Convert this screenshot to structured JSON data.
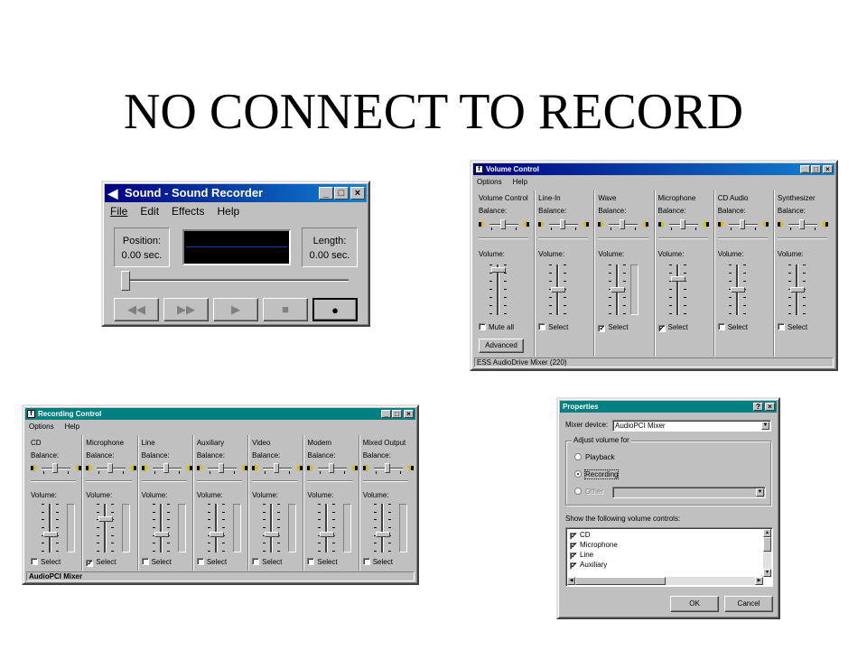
{
  "slide_title": "NO CONNECT TO RECORD",
  "sound_recorder": {
    "title": "Sound - Sound Recorder",
    "menu": [
      "File",
      "Edit",
      "Effects",
      "Help"
    ],
    "position_label": "Position:",
    "position_value": "0.00 sec.",
    "length_label": "Length:",
    "length_value": "0.00 sec.",
    "buttons": {
      "rewind": "◀◀",
      "forward": "▶▶",
      "play": "▶",
      "stop": "■",
      "record": "●"
    }
  },
  "volume_control": {
    "title": "Volume Control",
    "menu": [
      "Options",
      "Help"
    ],
    "balance_label": "Balance:",
    "volume_label": "Volume:",
    "columns": [
      {
        "name": "Volume Control",
        "check_label": "Mute all",
        "checked": false,
        "level": 0.95
      },
      {
        "name": "Line-In",
        "check_label": "Select",
        "checked": false,
        "level": 0.5
      },
      {
        "name": "Wave",
        "check_label": "Select",
        "checked": true,
        "level": 0.5
      },
      {
        "name": "Microphone",
        "check_label": "Select",
        "checked": true,
        "level": 0.75
      },
      {
        "name": "CD Audio",
        "check_label": "Select",
        "checked": false,
        "level": 0.5
      },
      {
        "name": "Synthesizer",
        "check_label": "Select",
        "checked": false,
        "level": 0.5
      }
    ],
    "advanced_label": "Advanced",
    "status": "ESS AudioDrive Mixer (220)"
  },
  "recording_control": {
    "title": "Recording Control",
    "menu": [
      "Options",
      "Help"
    ],
    "balance_label": "Balance:",
    "volume_label": "Volume:",
    "check_label": "Select",
    "columns": [
      {
        "name": "CD",
        "checked": false,
        "level": 0.35
      },
      {
        "name": "Microphone",
        "checked": true,
        "level": 0.7
      },
      {
        "name": "Line",
        "checked": false,
        "level": 0.35
      },
      {
        "name": "Auxiliary",
        "checked": false,
        "level": 0.35
      },
      {
        "name": "Video",
        "checked": false,
        "level": 0.35
      },
      {
        "name": "Modem",
        "checked": false,
        "level": 0.35
      },
      {
        "name": "Mixed Output",
        "checked": false,
        "level": 0.35
      }
    ],
    "status": "AudioPCI Mixer"
  },
  "properties": {
    "title": "Properties",
    "help_btn": "?",
    "mixer_device_label": "Mixer device:",
    "mixer_device_value": "AudioPCI Mixer",
    "adjust_label": "Adjust volume for",
    "radio_playback": "Playback",
    "radio_recording": "Recording",
    "radio_other": "Other",
    "show_label": "Show the following volume controls:",
    "list_items": [
      "CD",
      "Microphone",
      "Line",
      "Auxiliary"
    ],
    "ok_label": "OK",
    "cancel_label": "Cancel"
  },
  "colors": {
    "active_title": "#000080",
    "teal_title": "#008080",
    "face": "#c0c0c0"
  }
}
